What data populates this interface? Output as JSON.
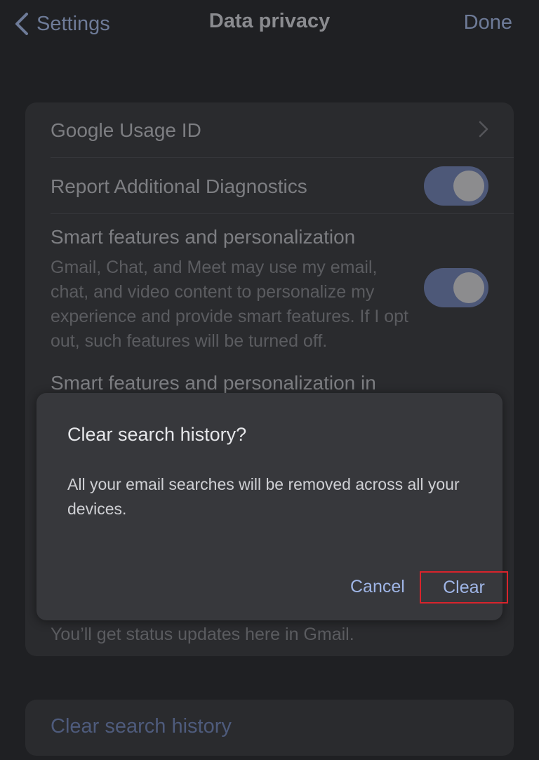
{
  "nav": {
    "back_label": "Settings",
    "title": "Data privacy",
    "done_label": "Done"
  },
  "settings": {
    "usage_id_label": "Google Usage ID",
    "diagnostics_label": "Report Additional Diagnostics",
    "diagnostics_enabled": true,
    "smart_features_label": "Smart features and personalization",
    "smart_features_desc": "Gmail, Chat, and Meet may use my email, chat, and video content to personalize my experience and provide smart features. If I opt out, such features will be turned off.",
    "smart_features_enabled": true,
    "smart_features_other_label": "Smart features and personalization in",
    "status_note": "You’ll get status updates here in Gmail."
  },
  "bottom": {
    "clear_history_link": "Clear search history"
  },
  "dialog": {
    "title": "Clear search history?",
    "body": "All your email searches will be removed across all your devices.",
    "cancel_label": "Cancel",
    "clear_label": "Clear"
  },
  "colors": {
    "accent": "#9fb5e6",
    "highlight": "#d8242c",
    "toggle_on": "#4d5878"
  }
}
